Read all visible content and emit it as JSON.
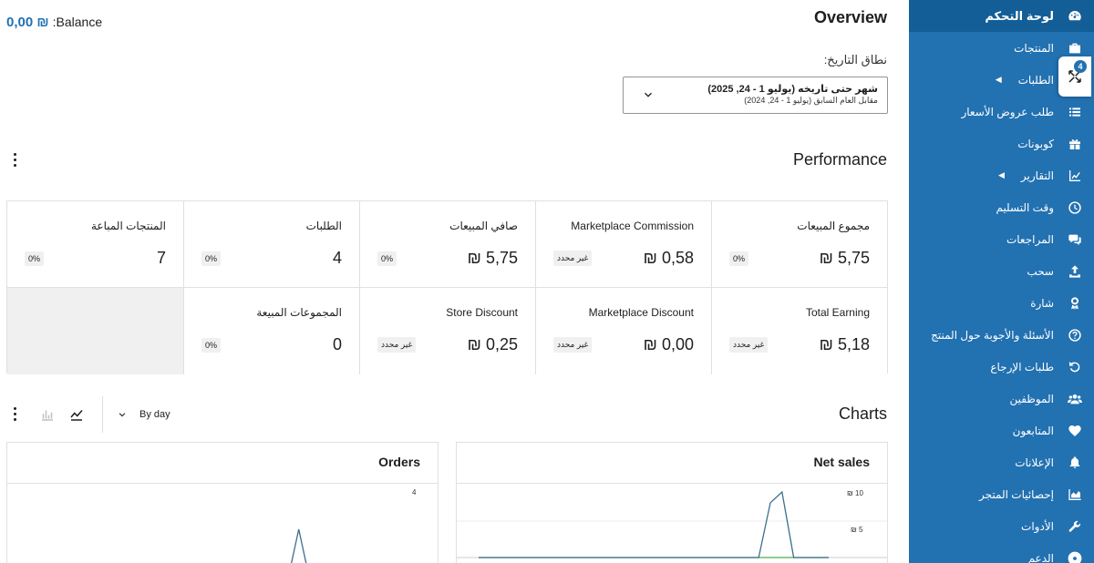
{
  "balance": {
    "label": ":Balance",
    "value": "0,00 ₪"
  },
  "header": {
    "title": "Overview"
  },
  "date_range": {
    "label": "نطاق التاريخ:",
    "primary": "شهر حتى تاريخه (يوليو 1 - 24, 2025)",
    "secondary": "مقابل العام السابق (يوليو 1 - 24, 2024)"
  },
  "performance": {
    "title": "Performance",
    "cells": [
      {
        "label": "مجموع المبيعات",
        "value": "₪ 5,75",
        "delta": "0%"
      },
      {
        "label": "Marketplace Commission",
        "value": "₪ 0,58",
        "delta": "غير محدد"
      },
      {
        "label": "صافي المبيعات",
        "value": "₪ 5,75",
        "delta": "0%"
      },
      {
        "label": "الطلبات",
        "value": "4",
        "delta": "0%"
      },
      {
        "label": "المنتجات المباعة",
        "value": "7",
        "delta": "0%"
      },
      {
        "label": "Total Earning",
        "value": "₪ 5,18",
        "delta": "غير محدد"
      },
      {
        "label": "Marketplace Discount",
        "value": "₪ 0,00",
        "delta": "غير محدد"
      },
      {
        "label": "Store Discount",
        "value": "₪ 0,25",
        "delta": "غير محدد"
      },
      {
        "label": "المجموعات المبيعة",
        "value": "0",
        "delta": "0%"
      }
    ]
  },
  "charts": {
    "title": "Charts",
    "interval": "By day",
    "orders": {
      "title": "Orders",
      "y_top_label": "4"
    },
    "net_sales": {
      "title": "Net sales",
      "y_labels": [
        "₪ 10",
        "₪ 5"
      ]
    }
  },
  "chart_data": [
    {
      "type": "line",
      "title": "Orders",
      "y_ticks": [
        "4"
      ],
      "series": [
        {
          "values": [
            0,
            0,
            0,
            0,
            0,
            0,
            0,
            0,
            0,
            0,
            0,
            0,
            0,
            0,
            0,
            0,
            0,
            0,
            0,
            0,
            0,
            0,
            0,
            4,
            0,
            0,
            0,
            0,
            0,
            0,
            0,
            0,
            0,
            0
          ]
        }
      ]
    },
    {
      "type": "line",
      "title": "Net sales",
      "y_ticks": [
        "₪ 10",
        "₪ 5"
      ],
      "ylim": [
        0,
        12
      ],
      "series": [
        {
          "values": [
            0,
            0,
            0,
            0,
            0,
            0,
            0,
            0,
            0,
            0,
            0,
            0,
            0,
            0,
            0,
            0,
            0,
            0,
            0,
            0,
            0,
            0,
            0,
            0,
            0,
            0,
            0,
            0,
            0,
            0,
            0
          ]
        },
        {
          "values": [
            0,
            0,
            0,
            0,
            0,
            0,
            0,
            0,
            0,
            0,
            0,
            0,
            0,
            0,
            0,
            0,
            0,
            0,
            0,
            0,
            0,
            0,
            0,
            0,
            0,
            8.6,
            10.3,
            0,
            0,
            0,
            0
          ]
        }
      ]
    }
  ],
  "sidebar": {
    "collapse_badge": "4",
    "items": [
      {
        "label": "لوحة التحكم",
        "icon": "dashboard-icon"
      },
      {
        "label": "المنتجات",
        "icon": "briefcase-icon"
      },
      {
        "label": "الطلبات",
        "icon": "cart-icon"
      },
      {
        "label": "طلب عروض الأسعار",
        "icon": "list-icon"
      },
      {
        "label": "كوبونات",
        "icon": "gift-icon"
      },
      {
        "label": "التقارير",
        "icon": "chart-icon"
      },
      {
        "label": "وقت التسليم",
        "icon": "clock-icon"
      },
      {
        "label": "المراجعات",
        "icon": "comments-icon"
      },
      {
        "label": "سحب",
        "icon": "upload-icon"
      },
      {
        "label": "شارة",
        "icon": "award-icon"
      },
      {
        "label": "الأسئلة والأجوبة حول المنتج",
        "icon": "question-icon"
      },
      {
        "label": "طلبات الإرجاع",
        "icon": "undo-icon"
      },
      {
        "label": "الموظفين",
        "icon": "users-icon"
      },
      {
        "label": "المتابعون",
        "icon": "heart-icon"
      },
      {
        "label": "الإعلانات",
        "icon": "bell-icon"
      },
      {
        "label": "إحصائيات المتجر",
        "icon": "area-chart-icon"
      },
      {
        "label": "الأدوات",
        "icon": "wrench-icon"
      },
      {
        "label": "الدعم",
        "icon": "lifebuoy-icon"
      }
    ]
  }
}
